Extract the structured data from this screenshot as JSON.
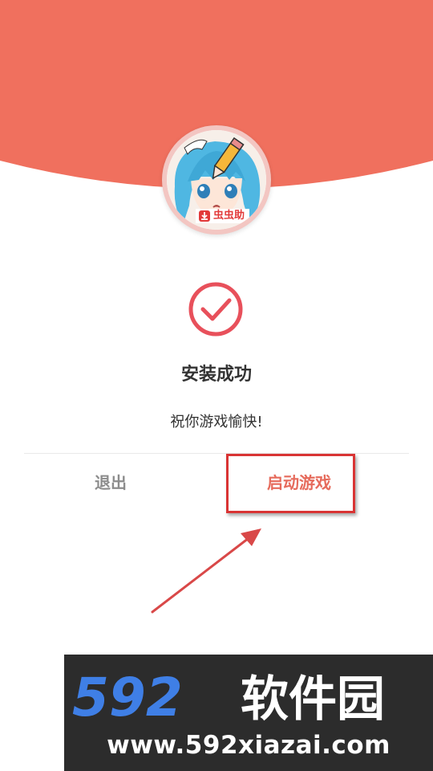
{
  "app": {
    "badge_text": "虫虫助"
  },
  "result": {
    "title": "安装成功",
    "message": "祝你游戏愉快!"
  },
  "actions": {
    "exit_label": "退出",
    "launch_label": "启动游戏"
  },
  "watermark": {
    "brand_digits": "592",
    "brand_text": "软件园",
    "url": "www.592xiazai.com"
  },
  "colors": {
    "header": "#f0705e",
    "accent": "#e8505b",
    "launch_text": "#e66b5c",
    "annotation": "#d93434"
  },
  "icons": {
    "status": "checkmark-circle-icon",
    "badge": "download-icon"
  }
}
